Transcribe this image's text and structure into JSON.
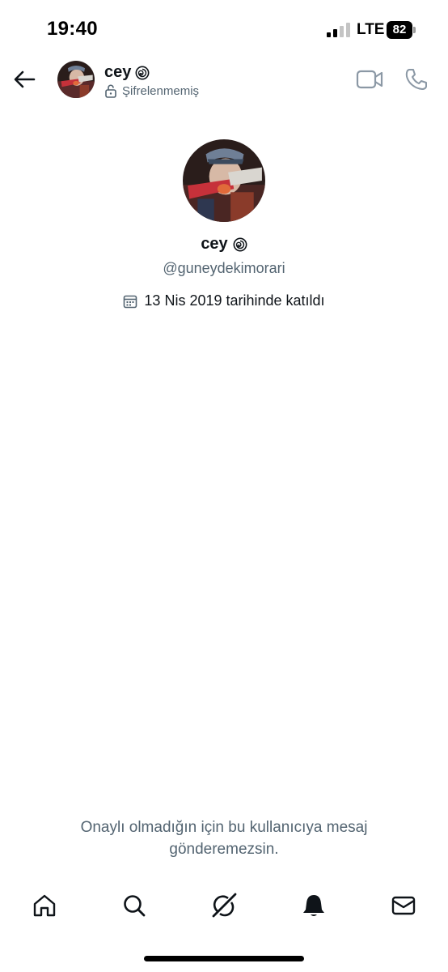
{
  "status_bar": {
    "time": "19:40",
    "network": "LTE",
    "battery": "82"
  },
  "header": {
    "name": "cey",
    "encryption_status": "Şifrelenmemiş"
  },
  "profile": {
    "name": "cey",
    "handle": "@guneydekimorari",
    "joined": "13 Nis 2019 tarihinde katıldı"
  },
  "notice": {
    "line1": "Onaylı olmadığın için bu kullanıcıya mesaj",
    "line2": "gönderemezsin."
  },
  "tabs": [
    {
      "icon": "home-icon"
    },
    {
      "icon": "search-icon"
    },
    {
      "icon": "grok-icon"
    },
    {
      "icon": "bell-icon"
    },
    {
      "icon": "mail-icon"
    }
  ],
  "colors": {
    "primary_text": "#0f1419",
    "secondary_text": "#536471",
    "icon_gray": "#8b98a5",
    "background": "#ffffff"
  }
}
